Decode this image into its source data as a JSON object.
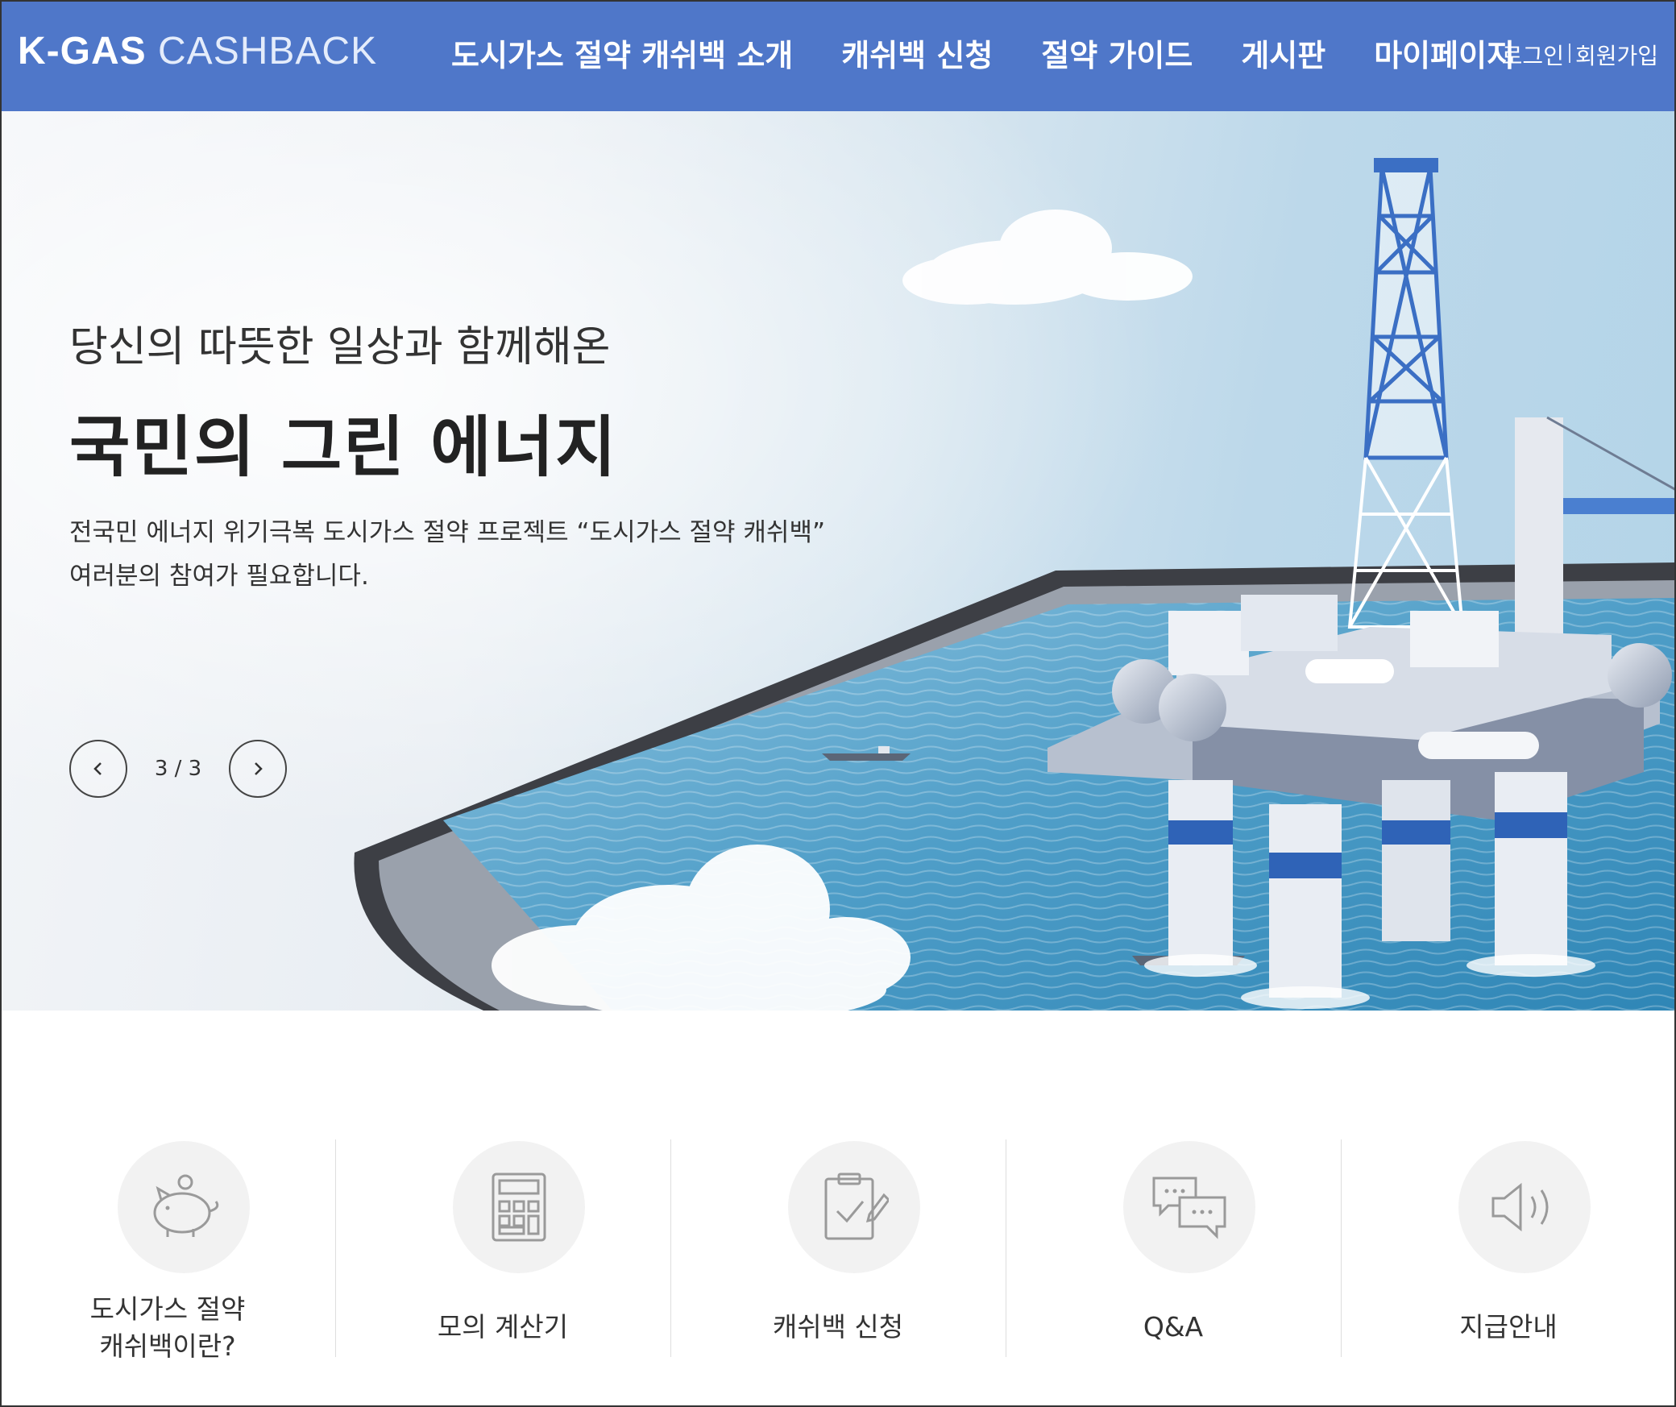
{
  "header": {
    "logo_bold": "K-GAS",
    "logo_light": " CASHBACK",
    "nav": [
      {
        "label": "도시가스 절약 캐쉬백 소개"
      },
      {
        "label": "캐쉬백 신청"
      },
      {
        "label": "절약 가이드"
      },
      {
        "label": "게시판"
      },
      {
        "label": "마이페이지"
      }
    ],
    "login": "로그인",
    "signup": "회원가입",
    "bg_color": "#4f77c9"
  },
  "hero": {
    "subtitle": "당신의 따뜻한 일상과 함께해온",
    "title": "국민의 그린 에너지",
    "desc_line1": "전국민 에너지 위기극복 도시가스 절약 프로젝트 “도시가스 절약 캐쉬백”",
    "desc_line2": "여러분의 참여가 필요합니다.",
    "slide_counter": "3 / 3",
    "prev_icon": "chevron-left-icon",
    "next_icon": "chevron-right-icon",
    "illustration": "offshore-gas-platform-on-tablet-screen"
  },
  "quick_menu": [
    {
      "line1": "도시가스 절약",
      "line2": "캐쉬백이란?",
      "icon": "piggy-bank-icon"
    },
    {
      "line1": "모의 계산기",
      "line2": "",
      "icon": "calculator-icon"
    },
    {
      "line1": "캐쉬백 신청",
      "line2": "",
      "icon": "clipboard-check-icon"
    },
    {
      "line1": "Q&A",
      "line2": "",
      "icon": "chat-bubbles-icon"
    },
    {
      "line1": "지급안내",
      "line2": "",
      "icon": "speaker-icon"
    }
  ]
}
